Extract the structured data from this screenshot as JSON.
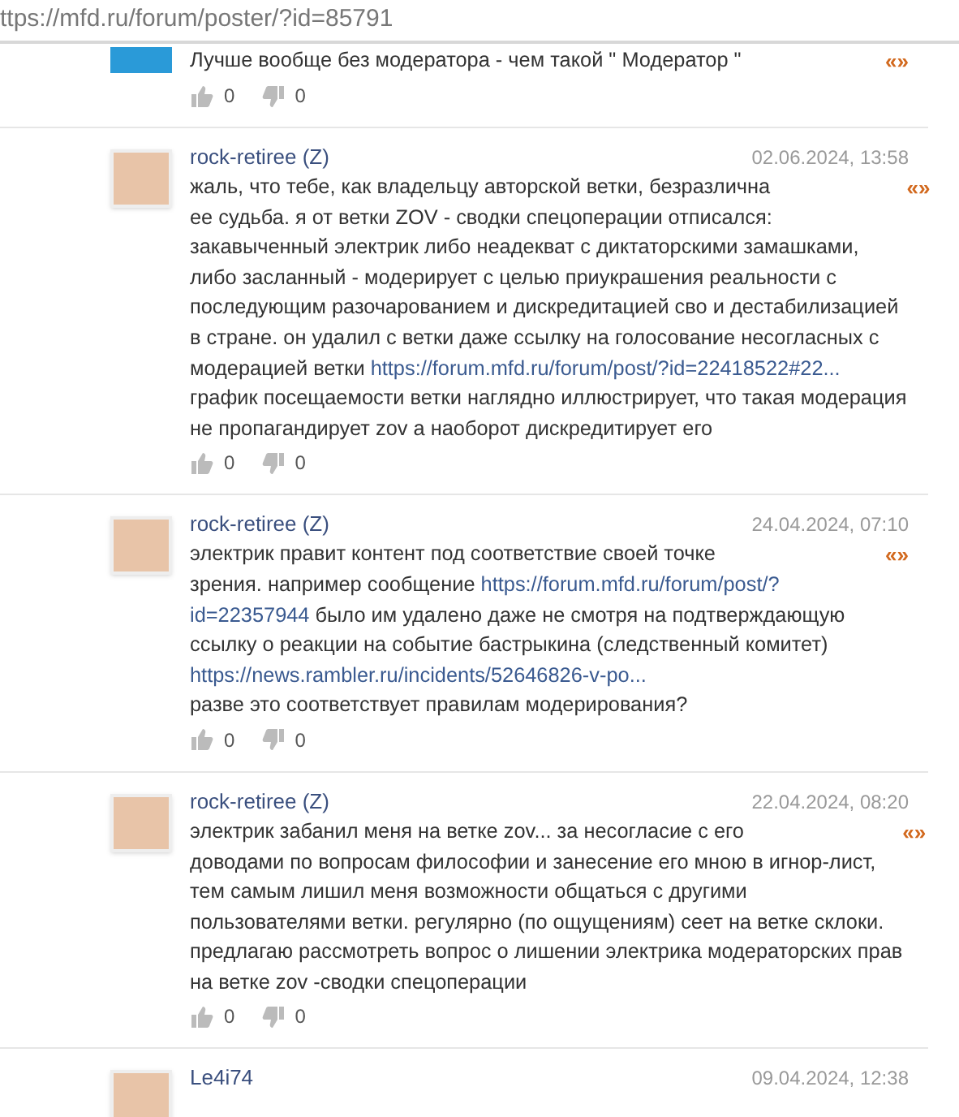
{
  "address_bar": {
    "url": "ttps://mfd.ru/forum/poster/?id=85791"
  },
  "posts": [
    {
      "quote": "«»",
      "body": [
        [
          {
            "kind": "text",
            "text": "Лучше вообще без модератора - чем такой \" Модератор \""
          }
        ]
      ],
      "likes": "0",
      "dislikes": "0"
    },
    {
      "author": "rock-retiree (Z)",
      "date": "02.06.2024, 13:58",
      "quote": "«»",
      "body": [
        [
          {
            "kind": "text",
            "text": "жаль, что тебе, как владельцу авторской ветки, безразлична"
          }
        ],
        [
          {
            "kind": "text",
            "text": "ее судьба. я от ветки ZOV - сводки спецоперации отписался:"
          }
        ],
        [
          {
            "kind": "text",
            "text": "закавыченный электрик либо неадекват с диктаторскими замашками,"
          }
        ],
        [
          {
            "kind": "text",
            "text": "либо засланный - модерирует с целью приукрашения реальности с"
          }
        ],
        [
          {
            "kind": "text",
            "text": "последующим разочарованием и дискредитацией сво и дестабилизацией"
          }
        ],
        [
          {
            "kind": "text",
            "text": "в стране. он удалил с ветки даже ссылку на голосование несогласных с"
          }
        ],
        [
          {
            "kind": "text",
            "text": "модерацией ветки "
          },
          {
            "kind": "link",
            "text": "https://forum.mfd.ru/forum/post/?id=22418522#22..."
          }
        ],
        [
          {
            "kind": "text",
            "text": "график посещаемости ветки наглядно иллюстрирует, что такая модерация"
          }
        ],
        [
          {
            "kind": "text",
            "text": "не пропагандирует zov а наоборот дискредитирует его"
          }
        ]
      ],
      "likes": "0",
      "dislikes": "0"
    },
    {
      "author": "rock-retiree (Z)",
      "date": "24.04.2024, 07:10",
      "quote": "«»",
      "body": [
        [
          {
            "kind": "text",
            "text": "электрик правит контент под соответствие своей точке"
          }
        ],
        [
          {
            "kind": "text",
            "text": "зрения. например сообщение "
          },
          {
            "kind": "link",
            "text": "https://forum.mfd.ru/forum/post/?"
          }
        ],
        [
          {
            "kind": "link",
            "text": "id=22357944"
          },
          {
            "kind": "text",
            "text": " было им удалено даже не смотря на подтверждающую"
          }
        ],
        [
          {
            "kind": "text",
            "text": "ссылку о реакции на событие бастрыкина (следственный комитет)"
          }
        ],
        [
          {
            "kind": "link",
            "text": "https://news.rambler.ru/incidents/52646826-v-po..."
          }
        ],
        [
          {
            "kind": "text",
            "text": "разве это соответствует правилам модерирования?"
          }
        ]
      ],
      "likes": "0",
      "dislikes": "0"
    },
    {
      "author": "rock-retiree (Z)",
      "date": "22.04.2024, 08:20",
      "quote": "«»",
      "body": [
        [
          {
            "kind": "text",
            "text": "электрик забанил меня на ветке zov... за несогласие с его"
          }
        ],
        [
          {
            "kind": "text",
            "text": "доводами по вопросам философии и занесение его мною в игнор-лист,"
          }
        ],
        [
          {
            "kind": "text",
            "text": "тем самым лишил меня возможности общаться с другими"
          }
        ],
        [
          {
            "kind": "text",
            "text": "пользователями ветки. регулярно (по ощущениям) сеет на ветке склоки."
          }
        ],
        [
          {
            "kind": "text",
            "text": "предлагаю рассмотреть вопрос о лишении электрика модераторских прав"
          }
        ],
        [
          {
            "kind": "text",
            "text": "на ветке zov -сводки спецоперации"
          }
        ]
      ],
      "likes": "0",
      "dislikes": "0"
    },
    {
      "author": "Le4i74",
      "date": "09.04.2024, 12:38"
    }
  ]
}
